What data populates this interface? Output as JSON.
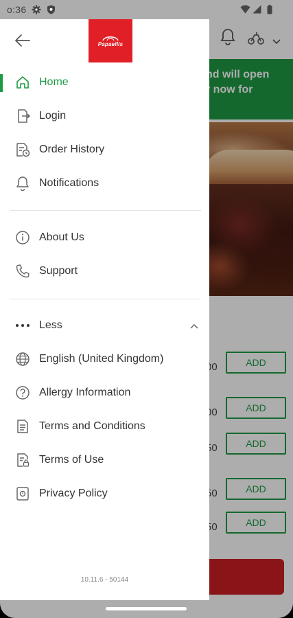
{
  "status_bar": {
    "time": "o:36"
  },
  "app_background": {
    "promo": {
      "line1": "nd will open",
      "line2": "r now for"
    },
    "menu_rows": [
      {
        "price": "00",
        "add_label": "ADD"
      },
      {
        "price": "00",
        "add_label": "ADD"
      },
      {
        "price": "50",
        "add_label": "ADD"
      },
      {
        "price": "50",
        "add_label": "ADD"
      },
      {
        "price": "50",
        "add_label": "ADD"
      }
    ]
  },
  "drawer": {
    "brand_logo_text": "Papaellis",
    "primary_items": [
      {
        "label": "Home",
        "icon": "home-icon",
        "active": true
      },
      {
        "label": "Login",
        "icon": "login-icon",
        "active": false
      },
      {
        "label": "Order History",
        "icon": "order-history-icon",
        "active": false
      },
      {
        "label": "Notifications",
        "icon": "bell-icon",
        "active": false
      }
    ],
    "info_items": [
      {
        "label": "About Us",
        "icon": "info-icon"
      },
      {
        "label": "Support",
        "icon": "phone-icon"
      }
    ],
    "less_toggle": {
      "label": "Less",
      "icon": "more-dots-icon"
    },
    "more_items": [
      {
        "label": "English (United Kingdom)",
        "icon": "globe-icon"
      },
      {
        "label": "Allergy Information",
        "icon": "question-icon"
      },
      {
        "label": "Terms and Conditions",
        "icon": "document-icon"
      },
      {
        "label": "Terms of Use",
        "icon": "document-lock-icon"
      },
      {
        "label": "Privacy Policy",
        "icon": "privacy-icon"
      }
    ],
    "version": "10.11.6 - 50144"
  },
  "colors": {
    "accent_green": "#1e9a45",
    "brand_red": "#e11f26"
  }
}
